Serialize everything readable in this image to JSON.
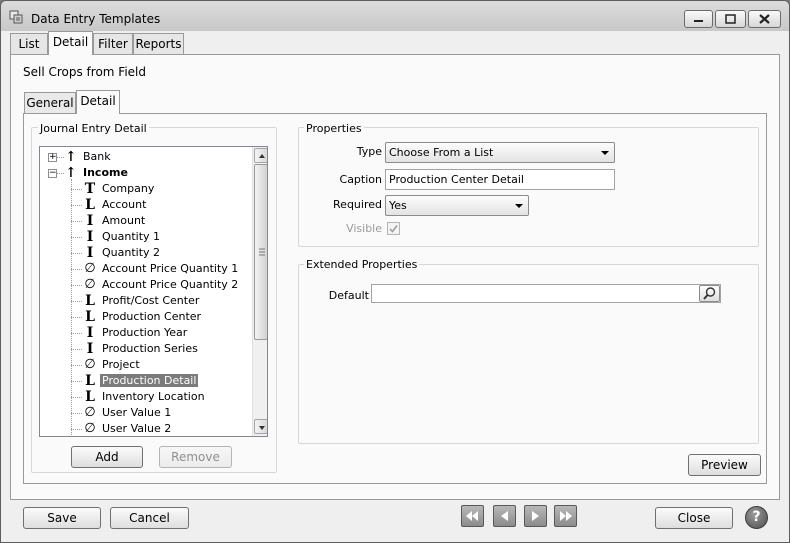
{
  "window": {
    "title": "Data Entry Templates",
    "controls": [
      "minimize-icon",
      "maximize-icon",
      "close-icon"
    ]
  },
  "tabs": [
    {
      "label": "List",
      "active": false
    },
    {
      "label": "Detail",
      "active": true
    },
    {
      "label": "Filter",
      "active": false
    },
    {
      "label": "Reports",
      "active": false
    }
  ],
  "record_title": "Sell Crops from Field",
  "subtabs": [
    {
      "label": "General",
      "active": false
    },
    {
      "label": "Detail",
      "active": true
    }
  ],
  "journal": {
    "group_label": "Journal Entry Detail",
    "tree": [
      {
        "label": "Bank",
        "glyph": "↑",
        "level": 0,
        "expander": "+",
        "bold": false,
        "selected": false
      },
      {
        "label": "Income",
        "glyph": "↑",
        "level": 0,
        "expander": "−",
        "bold": true,
        "selected": false
      },
      {
        "label": "Company",
        "glyph": "T",
        "level": 1,
        "bold": false,
        "selected": false
      },
      {
        "label": "Account",
        "glyph": "L",
        "level": 1,
        "bold": false,
        "selected": false
      },
      {
        "label": "Amount",
        "glyph": "I",
        "level": 1,
        "bold": false,
        "selected": false
      },
      {
        "label": "Quantity 1",
        "glyph": "I",
        "level": 1,
        "bold": false,
        "selected": false
      },
      {
        "label": "Quantity 2",
        "glyph": "I",
        "level": 1,
        "bold": false,
        "selected": false
      },
      {
        "label": "Account Price Quantity 1",
        "glyph": "∅",
        "level": 1,
        "bold": false,
        "selected": false
      },
      {
        "label": "Account Price Quantity 2",
        "glyph": "∅",
        "level": 1,
        "bold": false,
        "selected": false
      },
      {
        "label": "Profit/Cost Center",
        "glyph": "L",
        "level": 1,
        "bold": false,
        "selected": false
      },
      {
        "label": "Production Center",
        "glyph": "L",
        "level": 1,
        "bold": false,
        "selected": false
      },
      {
        "label": "Production Year",
        "glyph": "I",
        "level": 1,
        "bold": false,
        "selected": false
      },
      {
        "label": "Production Series",
        "glyph": "I",
        "level": 1,
        "bold": false,
        "selected": false
      },
      {
        "label": "Project",
        "glyph": "∅",
        "level": 1,
        "bold": false,
        "selected": false
      },
      {
        "label": "Production Detail",
        "glyph": "L",
        "level": 1,
        "bold": false,
        "selected": true
      },
      {
        "label": "Inventory Location",
        "glyph": "L",
        "level": 1,
        "bold": false,
        "selected": false
      },
      {
        "label": "User Value 1",
        "glyph": "∅",
        "level": 1,
        "bold": false,
        "selected": false
      },
      {
        "label": "User Value 2",
        "glyph": "∅",
        "level": 1,
        "bold": false,
        "selected": false
      }
    ],
    "add_label": "Add",
    "remove_label": "Remove"
  },
  "properties": {
    "group_label": "Properties",
    "type_label": "Type",
    "type_value": "Choose From a List",
    "caption_label": "Caption",
    "caption_value": "Production Center Detail",
    "required_label": "Required",
    "required_value": "Yes",
    "visible_label": "Visible",
    "visible_checked": true
  },
  "extended": {
    "group_label": "Extended Properties",
    "default_label": "Default",
    "default_value": ""
  },
  "preview_label": "Preview",
  "footer": {
    "save_label": "Save",
    "cancel_label": "Cancel",
    "close_label": "Close",
    "help_glyph": "?"
  }
}
